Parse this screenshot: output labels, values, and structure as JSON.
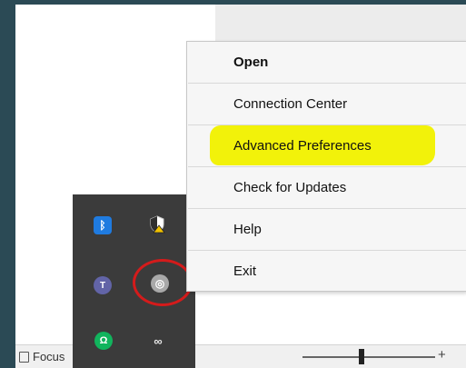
{
  "statusbar": {
    "focus_label": "Focus",
    "zoom_plus": "+"
  },
  "menu": {
    "items": [
      {
        "label": "Open"
      },
      {
        "label": "Connection Center"
      },
      {
        "label": "Advanced Preferences"
      },
      {
        "label": "Check for Updates"
      },
      {
        "label": "Help"
      },
      {
        "label": "Exit"
      }
    ]
  },
  "tray": {
    "icons": [
      {
        "name": "bluetooth-icon",
        "glyph": "ᛒ"
      },
      {
        "name": "shield-warning-icon"
      },
      {
        "name": "teams-icon",
        "glyph": "T"
      },
      {
        "name": "citrix-workspace-icon",
        "glyph": "◎"
      },
      {
        "name": "headset-icon",
        "glyph": "Ω"
      },
      {
        "name": "link-icon",
        "glyph": "∞"
      }
    ]
  },
  "annotations": {
    "highlight_color": "#f2f20a",
    "circle_color": "#d41b1b"
  }
}
